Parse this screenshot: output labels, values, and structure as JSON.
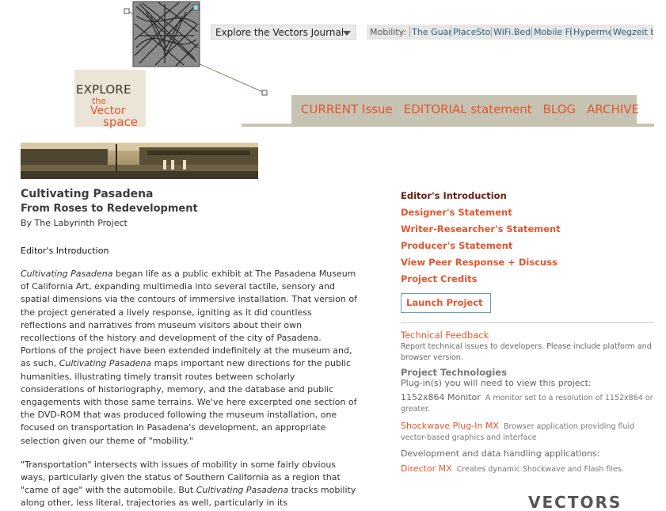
{
  "header": {
    "logo": {
      "line1": "EXPLORE",
      "line2": "the",
      "line3": "Vector",
      "line4": "space"
    },
    "journal_select": "Explore the Vectors Journal",
    "mobility": {
      "label": "Mobility:",
      "links": [
        "The Guan",
        "PlaceStor",
        "WiFi.Bedc",
        "Mobile Fig",
        "Hypermec",
        "Wegzeit b"
      ]
    },
    "nav": [
      "CURRENT Issue",
      "EDITORIAL statement",
      "BLOG",
      "ARCHIVE"
    ]
  },
  "article": {
    "title": "Cultivating Pasadena",
    "subtitle": "From Roses to Redevelopment",
    "byline": "By The Labyrinth Project",
    "section": "Editor's Introduction",
    "para1_em": "Cultivating Pasadena",
    "para1_a": " began life as a public exhibit at The Pasadena Museum of California Art, expanding multimedia into several tactile, sensory and spatial dimensions via the contours of immersive installation. That version of the project generated a lively response, igniting as it did countless reflections and narratives from museum visitors about their own recollections of the history and development of the city of Pasadena. Portions of the project have been extended indefinitely at the museum and, as such, ",
    "para1_em2": "Cultivating Pasadena",
    "para1_b": " maps important new directions for the public humanities, illustrating timely transit routes between scholarly considerations of historiography, memory, and the database and public engagements with those same terrains. We've here excerpted one section of the DVD-ROM that was produced following the museum installation, one focused on transportation in Pasadena's development, an appropriate selection given our theme of \"mobility.\"",
    "para2_a": "\"Transportation\" intersects with issues of mobility in some fairly obvious ways, particularly given the status of Southern California as a region that \"came of age\" with the automobile. But ",
    "para2_em": "Cultivating Pasadena",
    "para2_b": " tracks mobility along other, less literal, trajectories as well, particularly in its"
  },
  "sidebar": {
    "links": [
      "Editor's Introduction",
      "Designer's Statement",
      "Writer-Researcher's Statement",
      "Producer's Statement",
      "View Peer Response + Discuss",
      "Project Credits"
    ],
    "launch": "Launch Project",
    "tech_feedback": "Technical Feedback",
    "tech_desc": "Report technical issues to developers. Please include platform and browser version.",
    "tech_head": "Project Technologies",
    "plugin_note": "Plug-in(s) you will need to view this project:",
    "req1_name": "1152x864 Monitor",
    "req1_desc": "A monitor set to a resolution of 1152x864 or greater.",
    "req2_name": "Shockwave Plug-In  MX",
    "req2_desc": "Browser application providing fluid vector-based graphics and interface",
    "dev_note": "Development and data handling applications:",
    "req3_name": "Director MX",
    "req3_desc": "Creates dynamic Shockwave and Flash files."
  },
  "footer_logo": "VECTORS",
  "colors": {
    "accent": "#e0562f",
    "nav_bg": "#c7c3b2",
    "active_link": "#6b1f14"
  }
}
